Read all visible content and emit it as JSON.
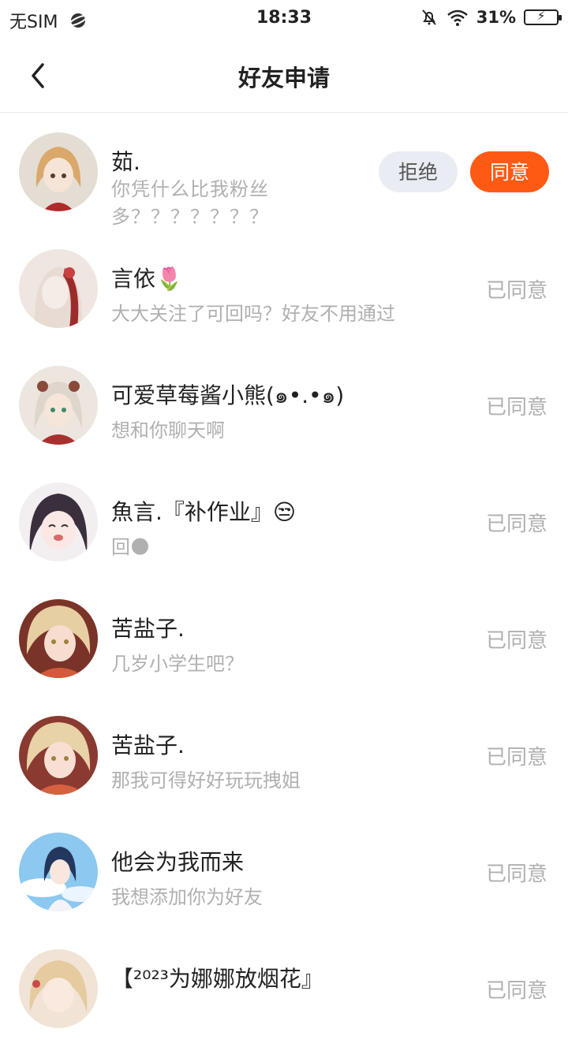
{
  "status_bar": {
    "carrier": "无SIM",
    "time": "18:33",
    "battery": "31%"
  },
  "header": {
    "title": "好友申请"
  },
  "requests": [
    {
      "name": "茹.",
      "message": "你凭什么比我粉丝多？？？？？？？",
      "reject_label": "拒绝",
      "accept_label": "同意"
    },
    {
      "name": "言依🌷",
      "message": "大大关注了可回吗？好友不用通过",
      "status": "已同意"
    },
    {
      "name": "可爱草莓酱小熊(๑•.•๑)",
      "message": "想和你聊天啊",
      "status": "已同意"
    },
    {
      "name": "魚言.『补作业』😒",
      "message": "回🌑",
      "status": "已同意"
    },
    {
      "name": "苦盐子.",
      "message": "几岁小学生吧？",
      "status": "已同意"
    },
    {
      "name": "苦盐子.",
      "message": "那我可得好好玩玩拽姐",
      "status": "已同意"
    },
    {
      "name": "他会为我而来",
      "message": "我想添加你为好友",
      "status": "已同意"
    },
    {
      "name": "【²⁰²³为娜娜放烟花』",
      "message": "",
      "status": "已同意"
    }
  ],
  "colors": {
    "accent": "#ff5a14",
    "reject_bg": "#e9edf3",
    "muted_text": "#b0b0b0"
  }
}
